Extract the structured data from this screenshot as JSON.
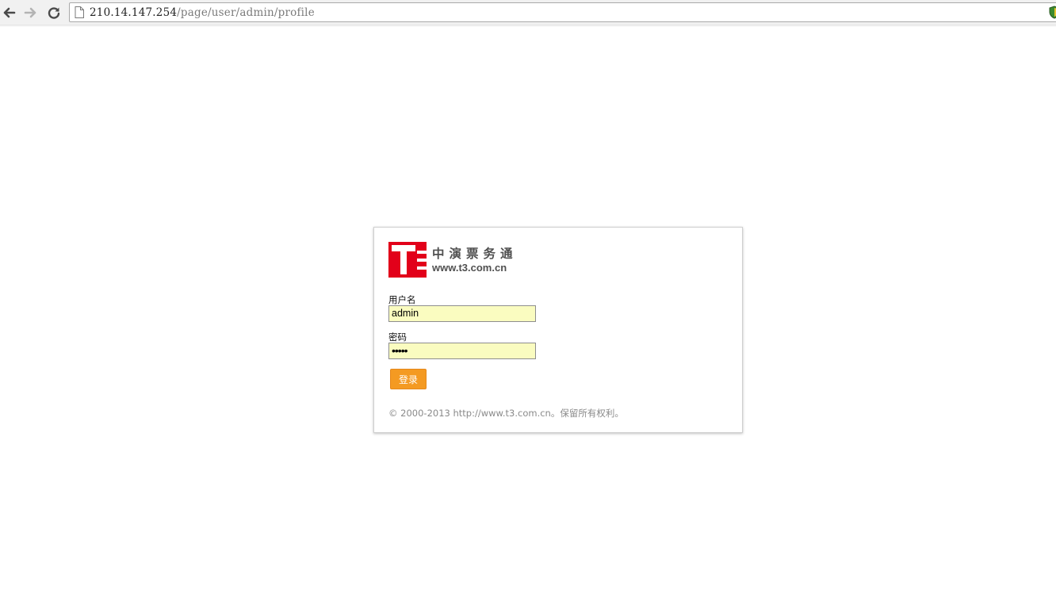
{
  "browser": {
    "url_host": "210.14.147.254",
    "url_path": "/page/user/admin/profile"
  },
  "icons": {
    "back": "back-arrow-icon",
    "forward": "forward-arrow-icon",
    "reload": "reload-icon",
    "page": "page-icon",
    "extension": "shield-extension-icon"
  },
  "login": {
    "logo_title": "中演票务通",
    "logo_url": "www.t3.com.cn",
    "username_label": "用户名",
    "username_value": "admin",
    "password_label": "密码",
    "password_mask": "•••••",
    "submit_label": "登录",
    "copyright": "© 2000-2013 http://www.t3.com.cn。保留所有权利。"
  },
  "colors": {
    "logo_red": "#e2001a",
    "button_orange": "#f49a22",
    "input_autofill": "#fafcc0"
  }
}
